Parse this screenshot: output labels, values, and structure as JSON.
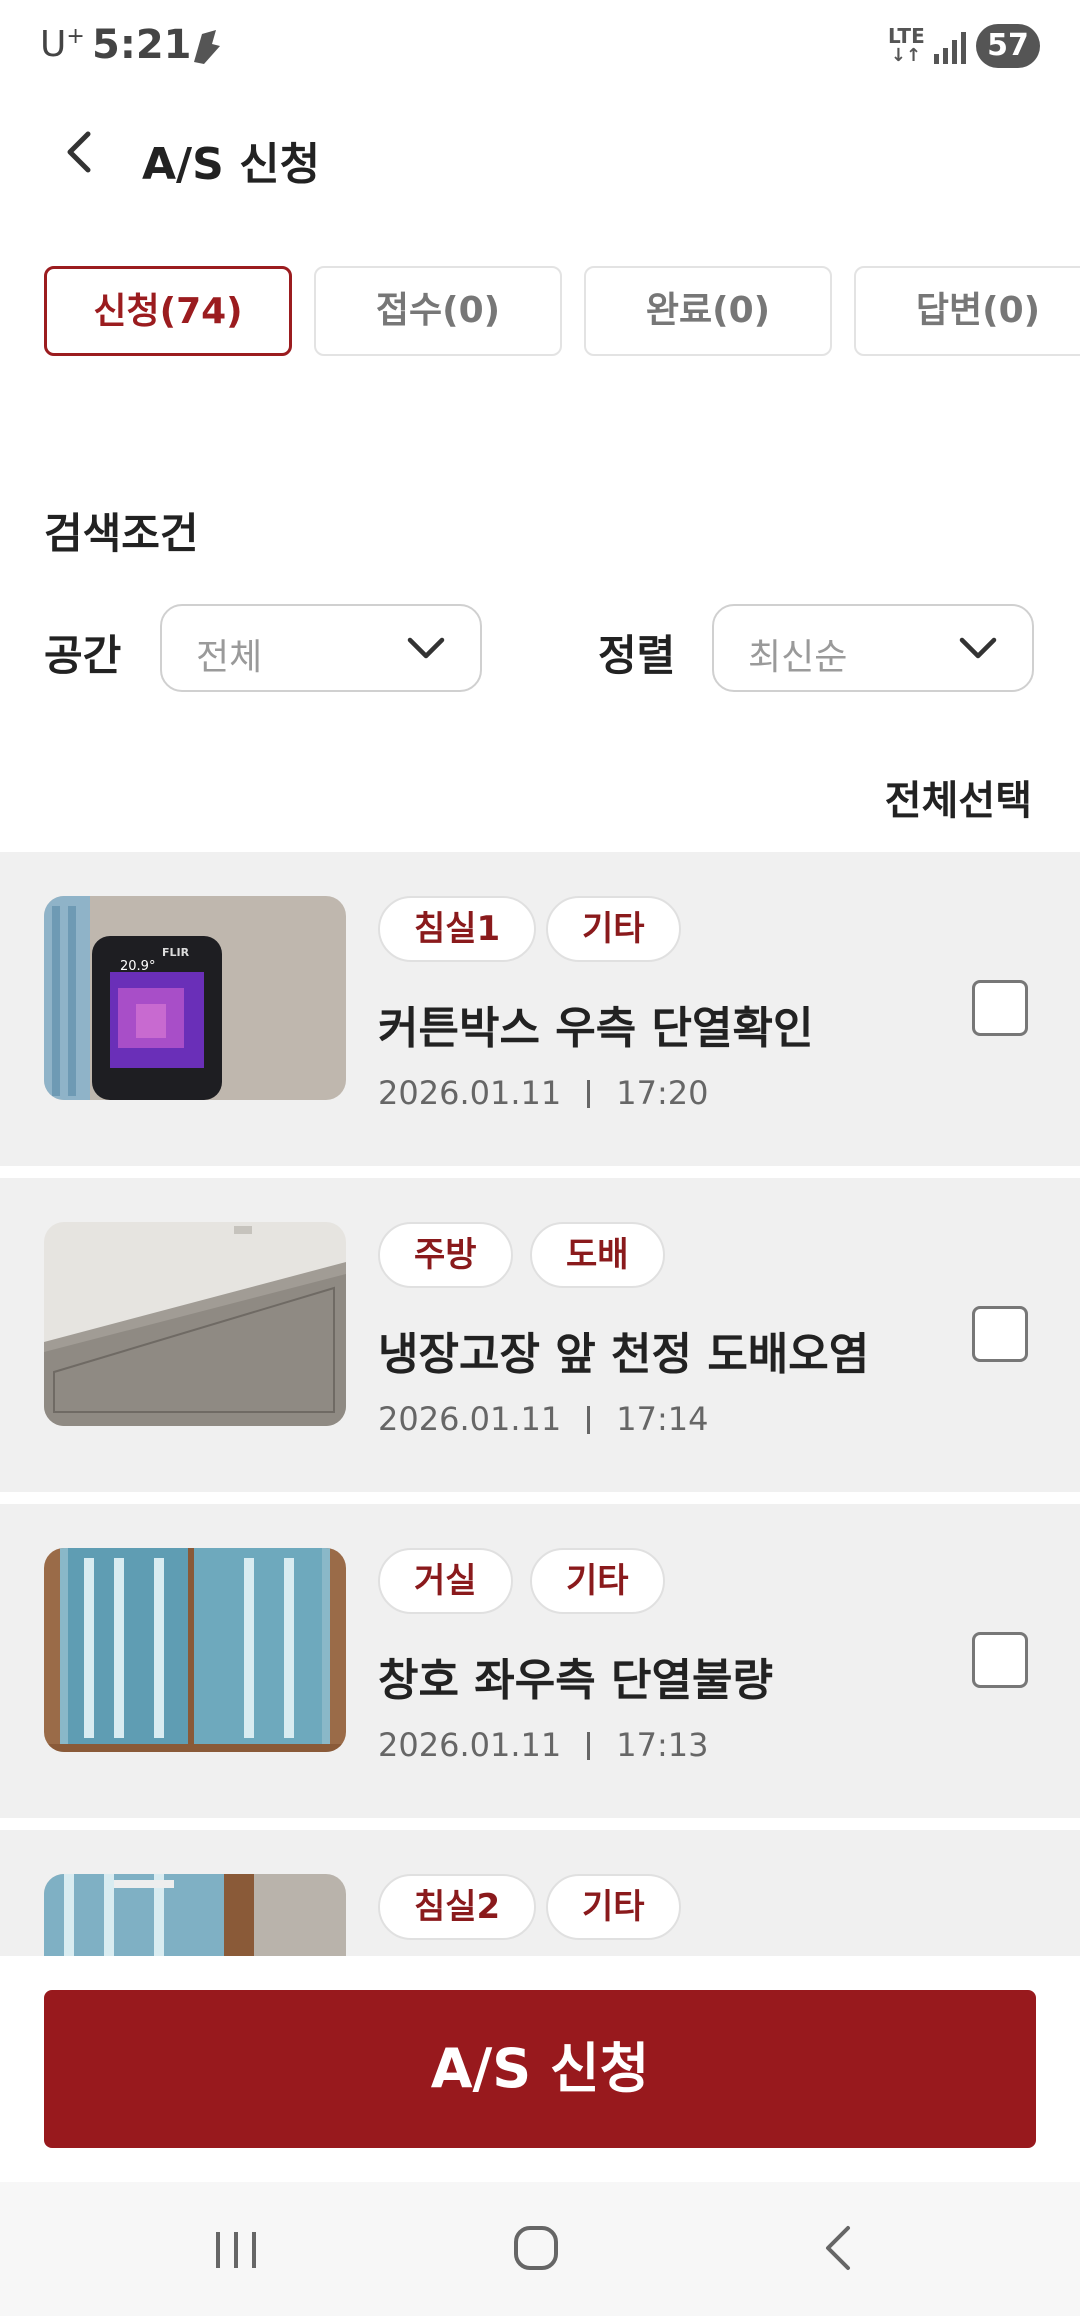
{
  "status_bar": {
    "carrier": "U",
    "carrier_sup": "+",
    "time": "5:21",
    "network": "LTE",
    "battery": "57"
  },
  "header": {
    "title": "A/S 신청"
  },
  "tabs": [
    {
      "label": "신청(74)",
      "active": true
    },
    {
      "label": "접수(0)",
      "active": false
    },
    {
      "label": "완료(0)",
      "active": false
    },
    {
      "label": "답변(0)",
      "active": false
    }
  ],
  "search": {
    "title": "검색조건",
    "space_label": "공간",
    "space_value": "전체",
    "sort_label": "정렬",
    "sort_value": "최신순",
    "select_all": "전체선택"
  },
  "items": [
    {
      "tags": [
        "침실1",
        "기타"
      ],
      "title": "커튼박스 우측 단열확인",
      "date": "2026.01.11",
      "time": "17:20",
      "thumb_text": "20.9°"
    },
    {
      "tags": [
        "주방",
        "도배"
      ],
      "title": "냉장고장 앞 천정 도배오염",
      "date": "2026.01.11",
      "time": "17:14"
    },
    {
      "tags": [
        "거실",
        "기타"
      ],
      "title": "창호 좌우측 단열불량",
      "date": "2026.01.11",
      "time": "17:13"
    },
    {
      "tags": [
        "침실2",
        "기타"
      ],
      "title": "",
      "date": "",
      "time": ""
    }
  ],
  "cta": {
    "label": "A/S 신청"
  },
  "colors": {
    "accent": "#98191d",
    "card_bg": "#f0f0f0"
  },
  "icons": {
    "back": "chevron-left-icon",
    "dropdown": "chevron-down-icon",
    "nav_recents": "recents-icon",
    "nav_home": "home-icon",
    "nav_back": "back-icon"
  }
}
